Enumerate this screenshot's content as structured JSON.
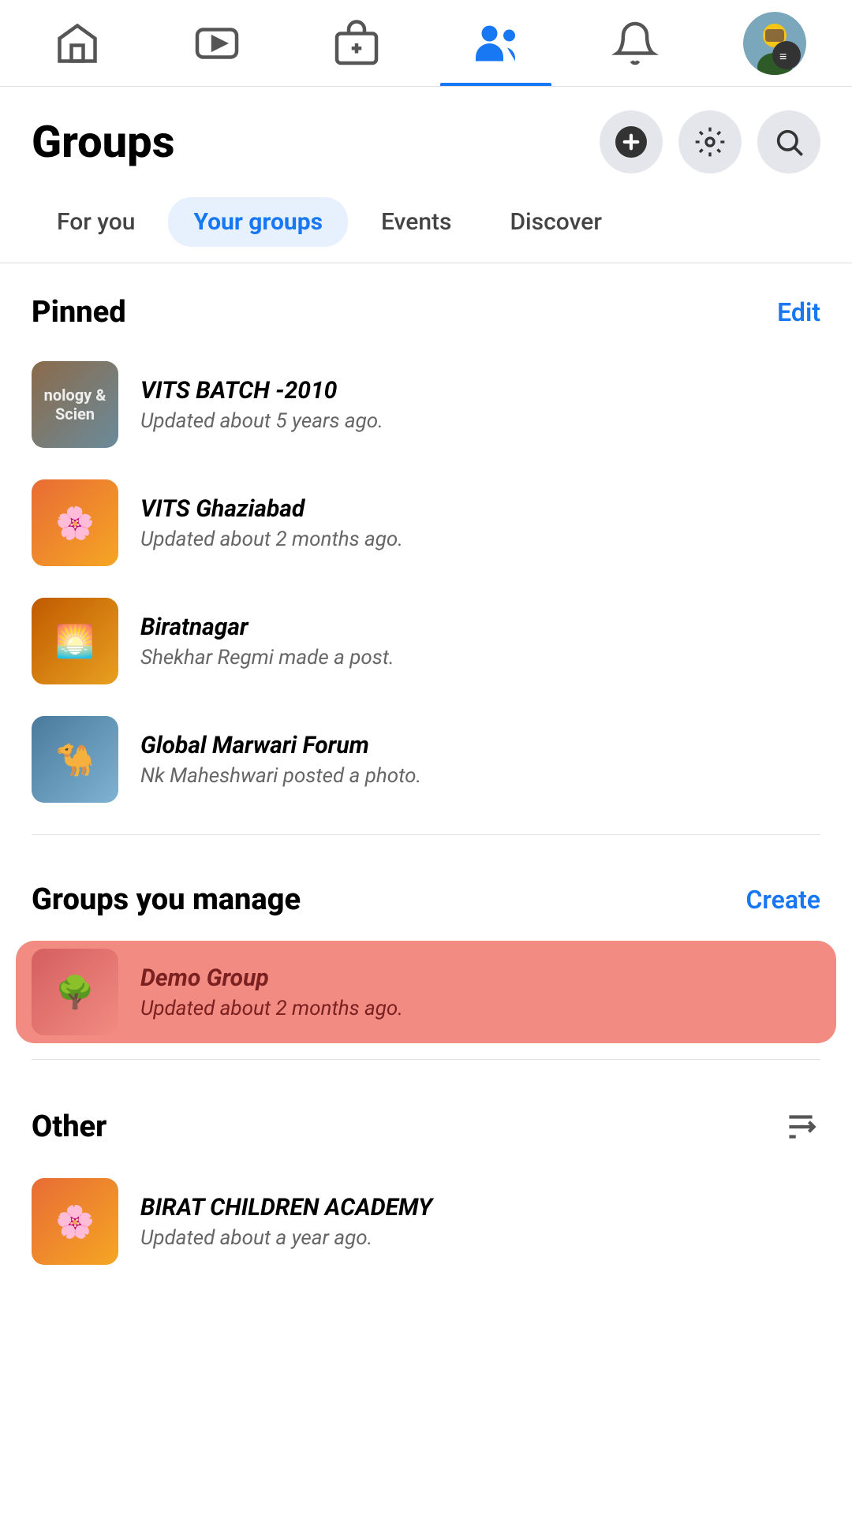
{
  "nav": {
    "items": [
      {
        "name": "home",
        "label": "Home",
        "active": false
      },
      {
        "name": "video",
        "label": "Video",
        "active": false
      },
      {
        "name": "store",
        "label": "Store",
        "active": false
      },
      {
        "name": "people",
        "label": "People",
        "active": true
      },
      {
        "name": "bell",
        "label": "Notifications",
        "active": false
      },
      {
        "name": "avatar",
        "label": "Profile",
        "active": false
      }
    ]
  },
  "header": {
    "title": "Groups",
    "add_label": "Add",
    "settings_label": "Settings",
    "search_label": "Search"
  },
  "tabs": [
    {
      "label": "For you",
      "active": false
    },
    {
      "label": "Your groups",
      "active": true
    },
    {
      "label": "Events",
      "active": false
    },
    {
      "label": "Discover",
      "active": false
    }
  ],
  "pinned": {
    "section_title": "Pinned",
    "edit_label": "Edit",
    "groups": [
      {
        "name": "VITS BATCH -2010",
        "subtitle": "Updated about 5 years ago.",
        "thumb_type": "vits-batch"
      },
      {
        "name": "VITS Ghaziabad",
        "subtitle": "Updated about 2 months ago.",
        "thumb_type": "vits-ghaz"
      },
      {
        "name": "Biratnagar",
        "subtitle": "Shekhar Regmi made a post.",
        "thumb_type": "biratnagar"
      },
      {
        "name": "Global Marwari Forum",
        "subtitle": "Nk Maheshwari posted a photo.",
        "thumb_type": "global-marwari"
      }
    ]
  },
  "managed": {
    "section_title": "Groups you manage",
    "create_label": "Create",
    "groups": [
      {
        "name": "Demo Group",
        "subtitle": "Updated about 2 months ago.",
        "thumb_type": "demo",
        "highlighted": true
      }
    ]
  },
  "other": {
    "section_title": "Other",
    "sort_label": "Sort",
    "groups": [
      {
        "name": "BIRAT CHILDREN ACADEMY",
        "subtitle": "Updated about a year ago.",
        "thumb_type": "birat-children"
      }
    ]
  },
  "colors": {
    "accent": "#1877f2",
    "highlight_bg": "#f28b82"
  }
}
